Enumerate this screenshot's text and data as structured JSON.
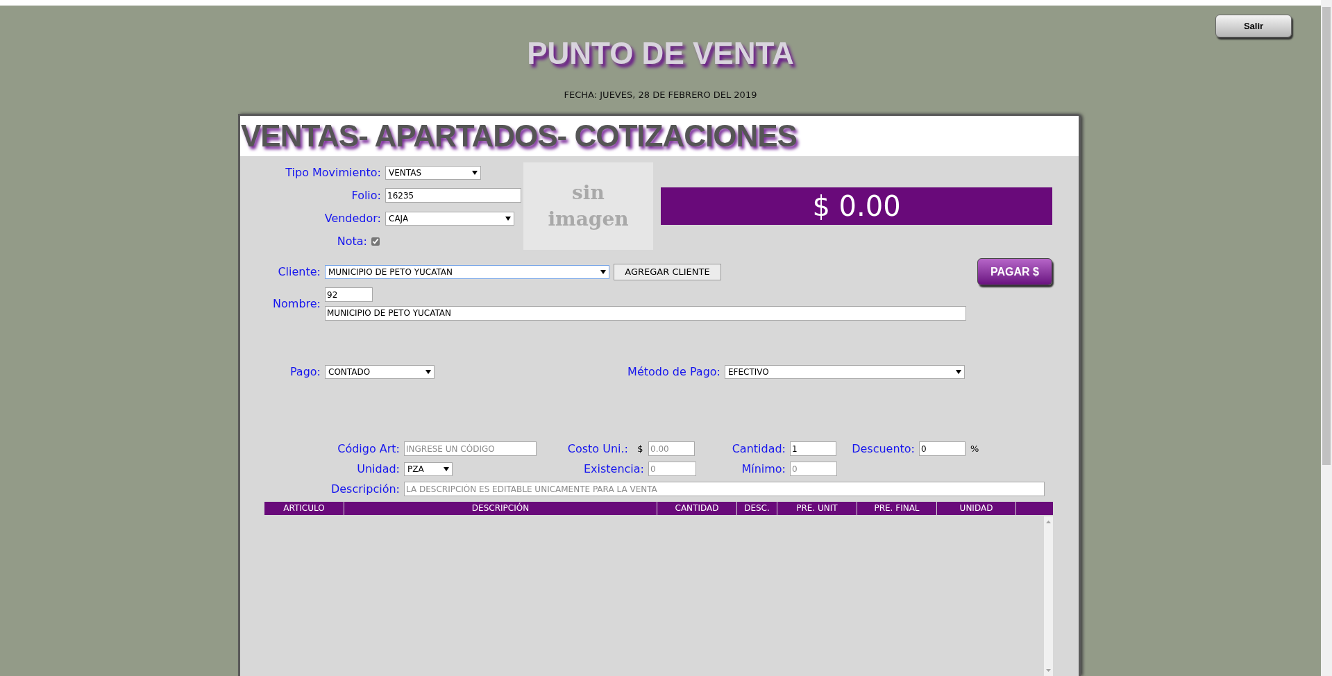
{
  "header": {
    "title": "PUNTO DE VENTA",
    "date": "FECHA: JUEVES, 28 DE FEBRERO DEL 2019"
  },
  "exit_button": "Salir",
  "panel": {
    "title": "VENTAS- APARTADOS- COTIZACIONES"
  },
  "tipo_movimiento": {
    "label": "Tipo Movimiento:",
    "value": "VENTAS"
  },
  "folio": {
    "label": "Folio:",
    "value": "16235"
  },
  "vendedor": {
    "label": "Vendedor:",
    "value": "CAJA"
  },
  "nota": {
    "label": "Nota:",
    "checked": true
  },
  "image_placeholder": {
    "text": "sin imagen"
  },
  "total": "$ 0.00",
  "cliente": {
    "label": "Cliente:",
    "value": "MUNICIPIO DE PETO YUCATAN",
    "focused": true,
    "add_button": "AGREGAR CLIENTE"
  },
  "pay_button": "PAGAR $",
  "nombre": {
    "label": "Nombre:",
    "code": "92",
    "value": "MUNICIPIO DE PETO YUCATAN"
  },
  "pago": {
    "label": "Pago:",
    "value": "CONTADO"
  },
  "metodo_pago": {
    "label": "Método de Pago:",
    "value": "EFECTIVO"
  },
  "codigo": {
    "label": "Código Art:",
    "placeholder": "INGRESE UN CÓDIGO"
  },
  "costo": {
    "label": "Costo Uni.:",
    "currency": "$",
    "placeholder": "0.00"
  },
  "cantidad": {
    "label": "Cantidad:",
    "value": "1"
  },
  "descuento": {
    "label": "Descuento:",
    "value": "0",
    "suffix": "%"
  },
  "unidad": {
    "label": "Unidad:",
    "value": "PZA"
  },
  "existencia": {
    "label": "Existencia:",
    "placeholder": "0"
  },
  "minimo": {
    "label": "Mínimo:",
    "placeholder": "0"
  },
  "descripcion": {
    "label": "Descripción:",
    "placeholder": "LA DESCRIPCIÓN ES EDITABLE UNICAMENTE PARA LA VENTA"
  },
  "table": {
    "columns": [
      "ARTICULO",
      "DESCRIPCIÓN",
      "CANTIDAD",
      "DESC.",
      "PRE. UNIT",
      "PRE. FINAL",
      "UNIDAD"
    ]
  }
}
